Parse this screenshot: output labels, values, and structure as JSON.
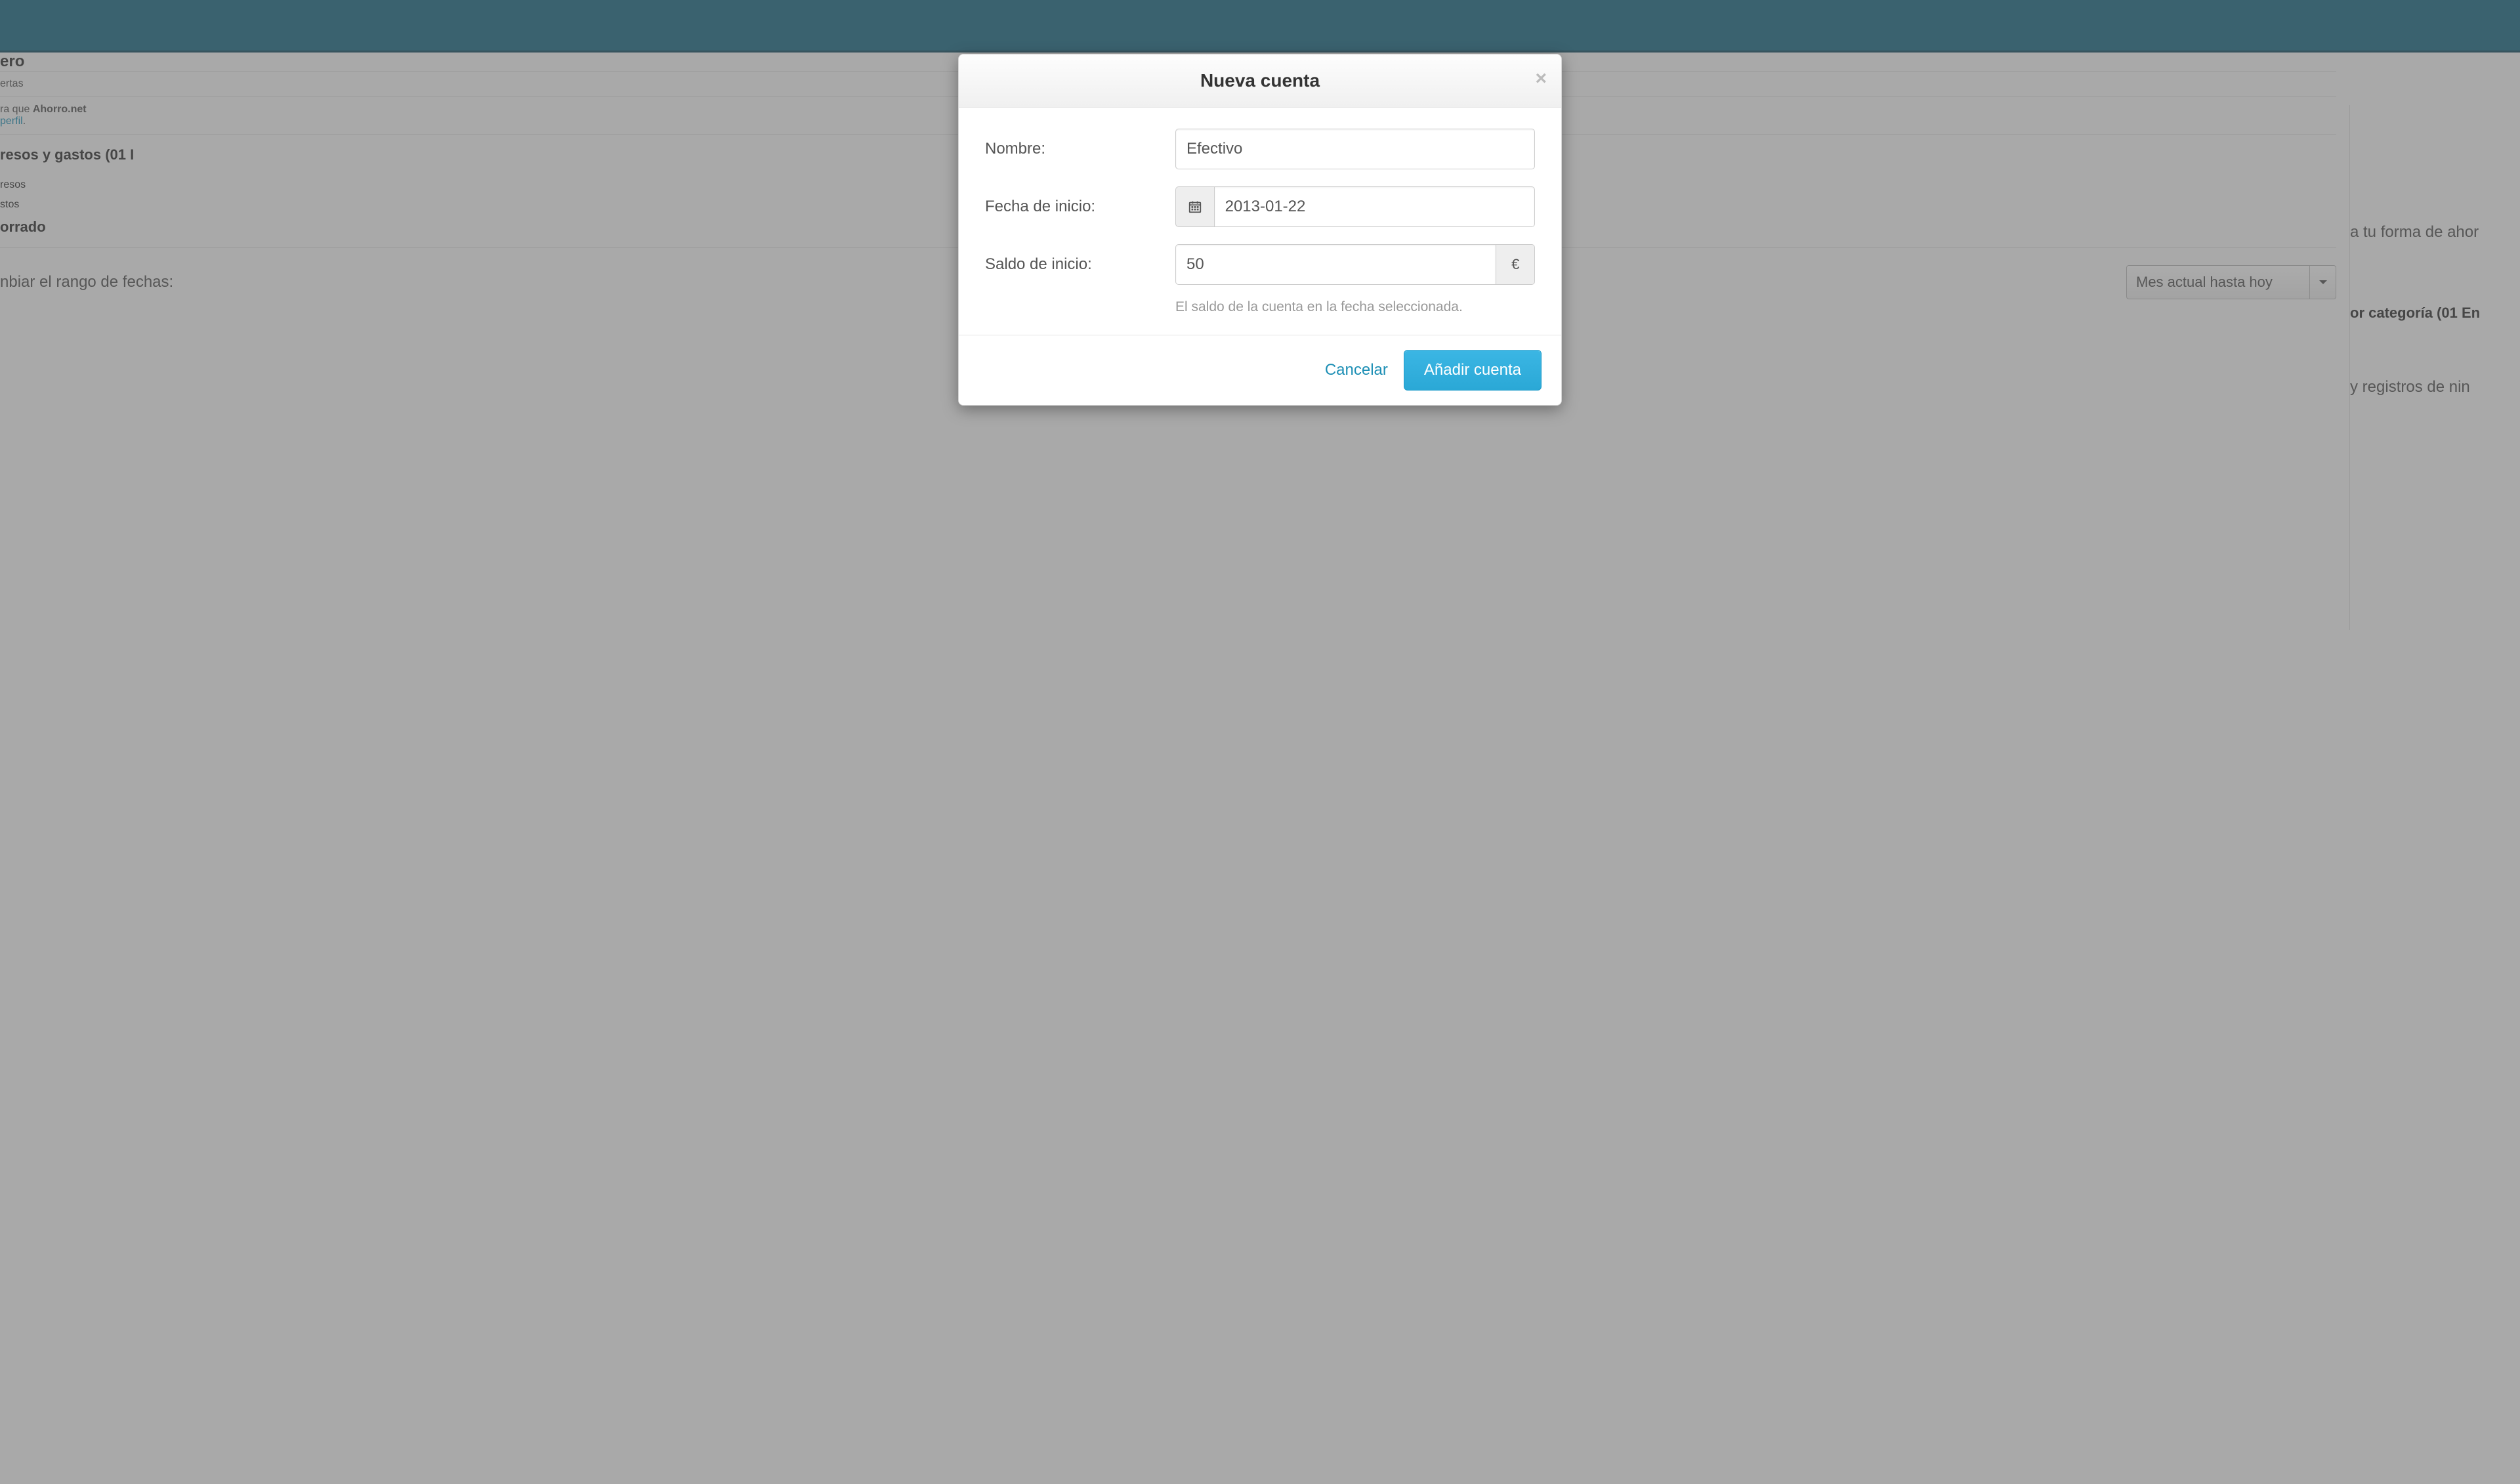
{
  "background": {
    "title_fragment": "ero",
    "row_ertas": "ertas",
    "intro_line_prefix": "ra que ",
    "intro_bold": "Ahorro.net",
    "intro_link": "perfil",
    "intro_suffix": ".",
    "right_intro": "a tu forma de ahor",
    "section_left": "resos y gastos (01 I",
    "section_right": "or categoría (01 En",
    "row_resos": "resos",
    "row_stos": "stos",
    "row_orrado": "orrado",
    "right_registros": "y registros de nin",
    "date_range_label": "nbiar el rango de fechas:",
    "date_range_value": "Mes actual hasta hoy"
  },
  "modal": {
    "title": "Nueva cuenta",
    "labels": {
      "nombre": "Nombre:",
      "fecha": "Fecha de inicio:",
      "saldo": "Saldo de inicio:"
    },
    "fields": {
      "nombre": "Efectivo",
      "fecha": "2013-01-22",
      "saldo": "50"
    },
    "currency": "€",
    "help": "El saldo de la cuenta en la fecha seleccionada.",
    "cancel": "Cancelar",
    "submit": "Añadir cuenta"
  }
}
